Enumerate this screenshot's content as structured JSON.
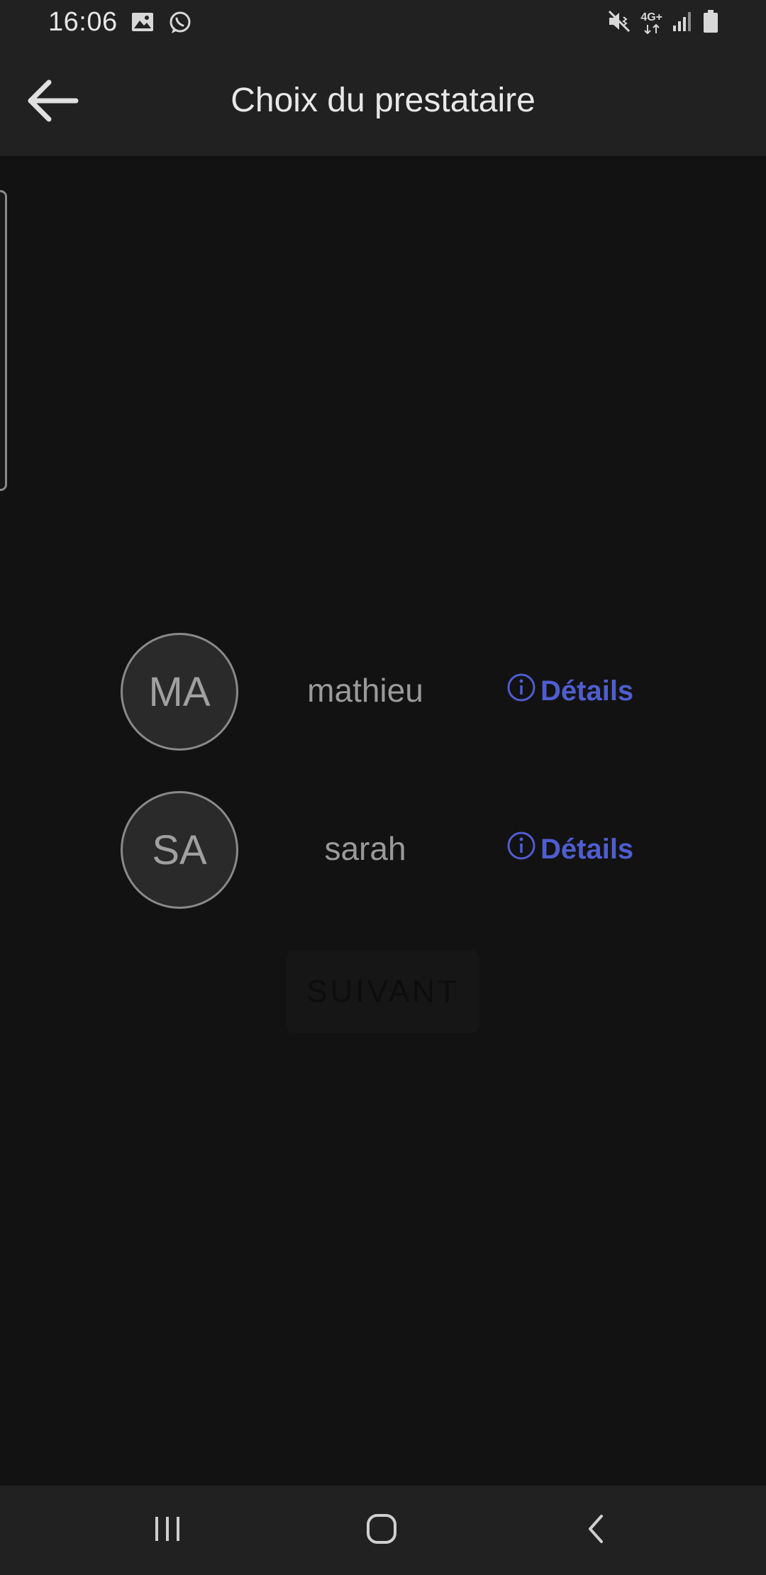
{
  "status_bar": {
    "time": "16:06",
    "left_icons": [
      "gallery-icon",
      "whatsapp-icon"
    ],
    "right_icons": [
      "mute-icon",
      "network-4g-icon",
      "signal-icon",
      "battery-icon"
    ],
    "network_label": "4G+"
  },
  "app_bar": {
    "title": "Choix du prestataire",
    "back_icon": "arrow-left-icon"
  },
  "providers": [
    {
      "initials": "MA",
      "name": "mathieu",
      "details_label": "Détails"
    },
    {
      "initials": "SA",
      "name": "sarah",
      "details_label": "Détails"
    }
  ],
  "next_button": {
    "label": "SUIVANT"
  },
  "colors": {
    "background": "#121212",
    "bar": "#212121",
    "accent": "#4f5dd0"
  },
  "nav_bar": {
    "icons": [
      "recent-apps-icon",
      "home-icon",
      "back-icon"
    ]
  }
}
